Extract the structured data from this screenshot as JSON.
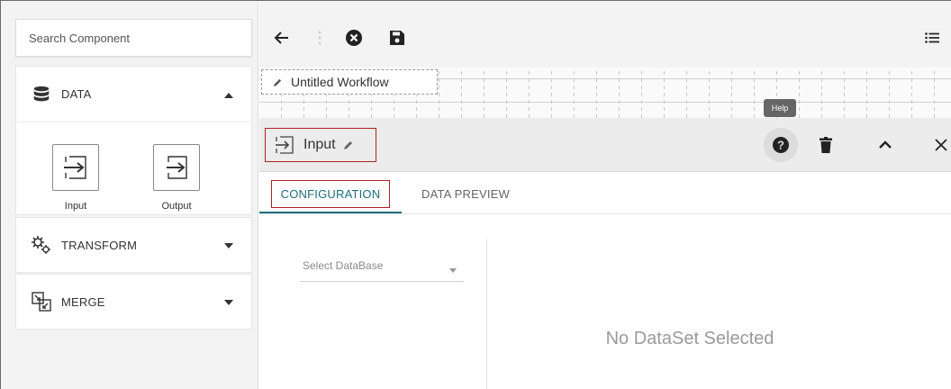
{
  "sidebar": {
    "search_placeholder": "Search Component",
    "sections": {
      "data": {
        "label": "DATA",
        "expanded": true,
        "icon": "database-icon"
      },
      "transform": {
        "label": "TRANSFORM",
        "expanded": false,
        "icon": "gears-icon"
      },
      "merge": {
        "label": "MERGE",
        "expanded": false,
        "icon": "merge-icon"
      }
    },
    "components": [
      {
        "label": "Input",
        "icon": "input-arrow-icon"
      },
      {
        "label": "Output",
        "icon": "output-arrow-icon"
      }
    ]
  },
  "toolbar": {
    "icons": [
      "back-arrow-icon",
      "kebab-menu-icon",
      "close-circle-icon",
      "save-icon",
      "list-menu-icon"
    ]
  },
  "workflow": {
    "title": "Untitled Workflow"
  },
  "node": {
    "title": "Input",
    "help_tooltip": "Help",
    "icons": [
      "help-icon",
      "delete-icon",
      "collapse-icon",
      "close-icon"
    ]
  },
  "tabs": [
    {
      "label": "CONFIGURATION",
      "active": true
    },
    {
      "label": "DATA PREVIEW",
      "active": false
    }
  ],
  "config": {
    "select_database_placeholder": "Select DataBase",
    "empty_message": "No DataSet Selected"
  },
  "colors": {
    "accent": "#1f6e78",
    "highlight_border": "#b02020",
    "sidebar_bg": "#f3f3f3"
  }
}
